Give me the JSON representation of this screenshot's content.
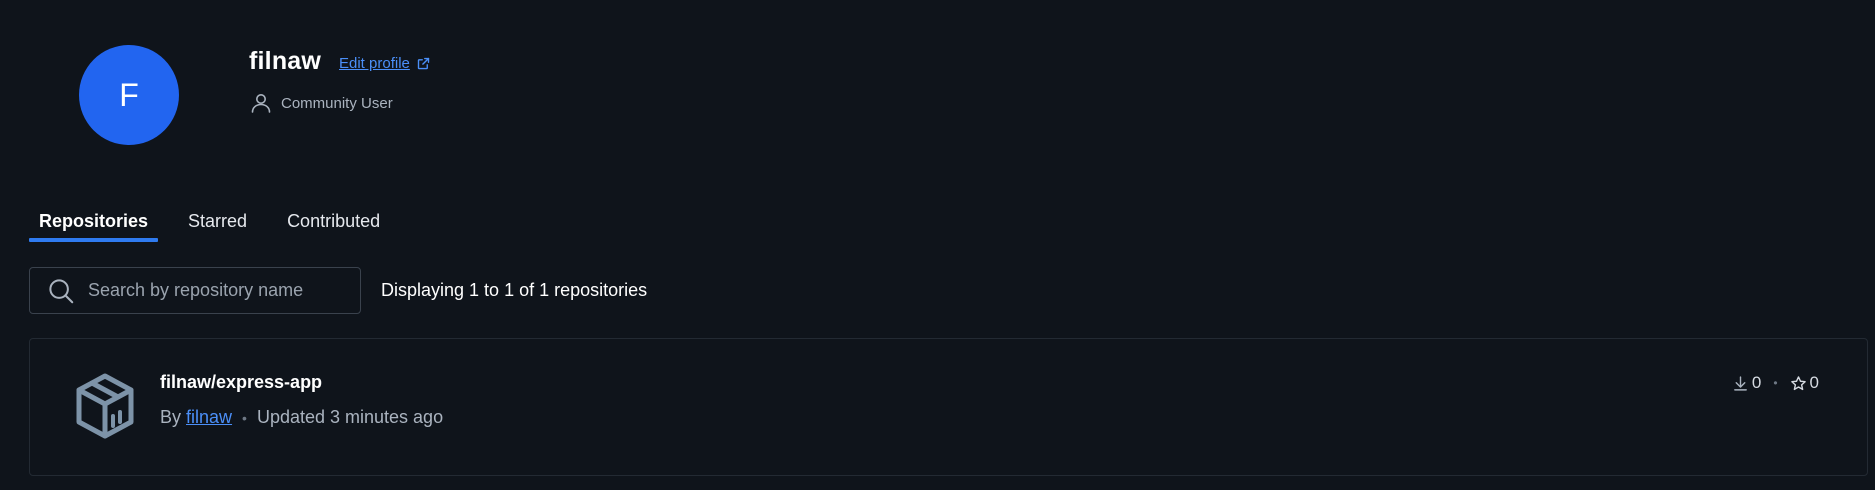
{
  "profile": {
    "avatar_letter": "F",
    "username": "filnaw",
    "edit_profile_label": "Edit profile",
    "role": "Community User"
  },
  "tabs": [
    {
      "label": "Repositories",
      "active": true
    },
    {
      "label": "Starred",
      "active": false
    },
    {
      "label": "Contributed",
      "active": false
    }
  ],
  "search": {
    "placeholder": "Search by repository name",
    "value": ""
  },
  "display_count": "Displaying 1 to 1 of 1 repositories",
  "repositories": [
    {
      "name": "filnaw/express-app",
      "by_label": "By",
      "author": "filnaw",
      "updated": "Updated 3 minutes ago",
      "pulls": "0",
      "stars": "0"
    }
  ],
  "colors": {
    "background": "#0f141b",
    "accent": "#2265f0",
    "link": "#4b8ff8"
  }
}
